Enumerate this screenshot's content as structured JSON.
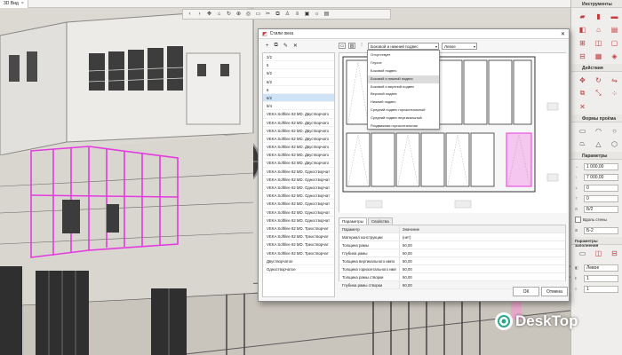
{
  "viewport_tab": {
    "label": "3D Вид"
  },
  "toolbar": {
    "buttons": [
      "back-icon",
      "forward-icon",
      "pan-icon",
      "home-icon",
      "refresh-icon",
      "zoom-icon",
      "orbit-icon",
      "section-icon",
      "cut-icon",
      "split-icon",
      "walk-icon",
      "layers-icon",
      "view-icon",
      "light-icon",
      "display-icon"
    ]
  },
  "tools_panel": {
    "title": "Инструменты",
    "actions_title": "Действия",
    "profile_shape_title": "Формы проёма",
    "params_title": "Параметры",
    "fill_params_title": "Параметры заполнения",
    "width_value": "1 000,00",
    "height_value": "7 000,00",
    "field_a": "0",
    "field_b": "0",
    "field_c": "Б/2",
    "wall_edge_label": "Вдоль стены",
    "field_d": "Б-2",
    "side_value": "Левое",
    "field_e": "1",
    "field_f": "1"
  },
  "dialog": {
    "title": "Стили окна",
    "style_list": [
      "2/2",
      "5",
      "5/2",
      "6/2",
      "8",
      "6/2",
      "9/4",
      "VEKA Softline 82 MD. Двустворчато",
      "VEKA Softline 82 MD. Двустворчато",
      "VEKA Softline 82 MD. Двустворчато",
      "VEKA Softline 82 MD. Двустворчато",
      "VEKA Softline 82 MD. Двустворчато",
      "VEKA Softline 82 MD. Двустворчато",
      "VEKA Softline 82 MD. Двустворчато",
      "VEKA Softline 82 MD. Одностворчат",
      "VEKA Softline 82 MD. Одностворчат",
      "VEKA Softline 82 MD. Одностворчат",
      "VEKA Softline 82 MD. Одностворчат",
      "VEKA Softline 82 MD. Одностворчат",
      "VEKA Softline 82 MD. Одностворчат",
      "VEKA Softline 82 MD. Одностворчат",
      "VEKA Softline 82 MD. Трехстворчат",
      "VEKA Softline 82 MD. Трехстворчат",
      "VEKA Softline 82 MD. Трехстворчат",
      "VEKA Softline 82 MD. Трехстворчат",
      "Двустворчатое",
      "Одностворчатое"
    ],
    "selected_index": 5,
    "preview_select": "Боковой и нижний подвес",
    "side_select": "Левое",
    "dropdown_options": [
      "Отсутствует",
      "Глухое",
      "Боковой подвес",
      "Боковой и нижний подвес",
      "Боковой и верхний подвес",
      "Верхний подвес",
      "Нижний подвес",
      "Средний подвес горизонтальный",
      "Средний подвес вертикальный",
      "Раздвижная горизонтальная"
    ],
    "highlighted_option": 3,
    "tabs": [
      "Параметры",
      "Свойства"
    ],
    "params_header": {
      "name": "Параметр",
      "value": "Значение"
    },
    "params": [
      {
        "name": "Материал конструкции",
        "value": "(нет)"
      },
      {
        "name": "Толщина рамы",
        "value": "50,00"
      },
      {
        "name": "Глубина рамы",
        "value": "50,00"
      },
      {
        "name": "Толщина вертикального импо",
        "value": "50,00"
      },
      {
        "name": "Толщина горизонтального имп",
        "value": "50,00"
      },
      {
        "name": "Толщина рамы створки",
        "value": "50,00"
      },
      {
        "name": "Глубина рамы створки",
        "value": "50,00"
      }
    ],
    "ok_label": "ОК",
    "cancel_label": "Отмена"
  },
  "watermark": {
    "text": "DeskTop"
  },
  "colors": {
    "highlight_magenta": "#e33be0",
    "accent_red": "#c23c3c",
    "selection_blue": "#cfe3f6"
  }
}
